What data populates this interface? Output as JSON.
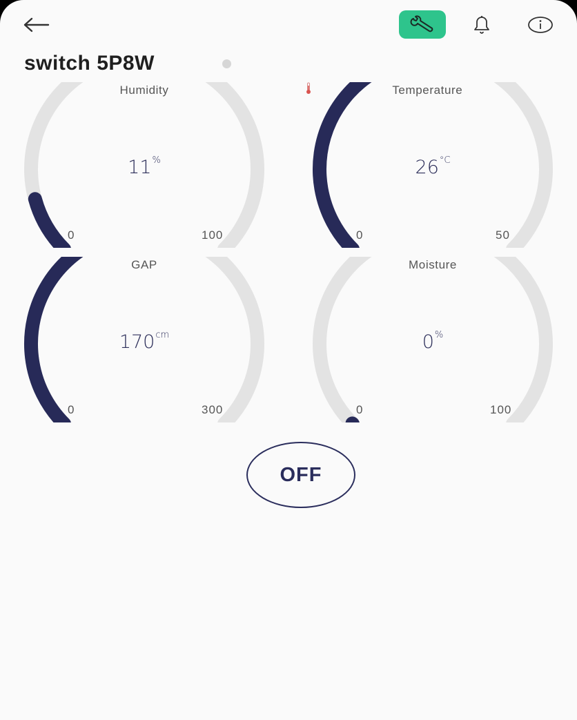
{
  "header": {
    "back_icon": "arrow-left-icon",
    "settings_icon": "wrench-icon",
    "settings_color": "#2ec48c",
    "notifications_icon": "bell-icon",
    "info_icon": "info-icon"
  },
  "device": {
    "name": "switch 5P8W",
    "status_dot_color": "#d6d6d6"
  },
  "gauges": [
    {
      "label": "Humidity",
      "value": "11",
      "unit": "%",
      "min": "0",
      "max": "100",
      "fraction": 0.11
    },
    {
      "label": "Temperature",
      "value": "26",
      "unit": "°C",
      "min": "0",
      "max": "50",
      "fraction": 0.52,
      "label_icon": "thermometer-icon"
    },
    {
      "label": "GAP",
      "value": "170",
      "unit": "cm",
      "min": "0",
      "max": "300",
      "fraction": 0.5667
    },
    {
      "label": "Moisture",
      "value": "0",
      "unit": "%",
      "min": "0",
      "max": "100",
      "fraction": 0
    }
  ],
  "colors": {
    "gauge_fill": "#272a58",
    "gauge_track": "#e3e3e3"
  },
  "power_button": {
    "label": "OFF"
  }
}
